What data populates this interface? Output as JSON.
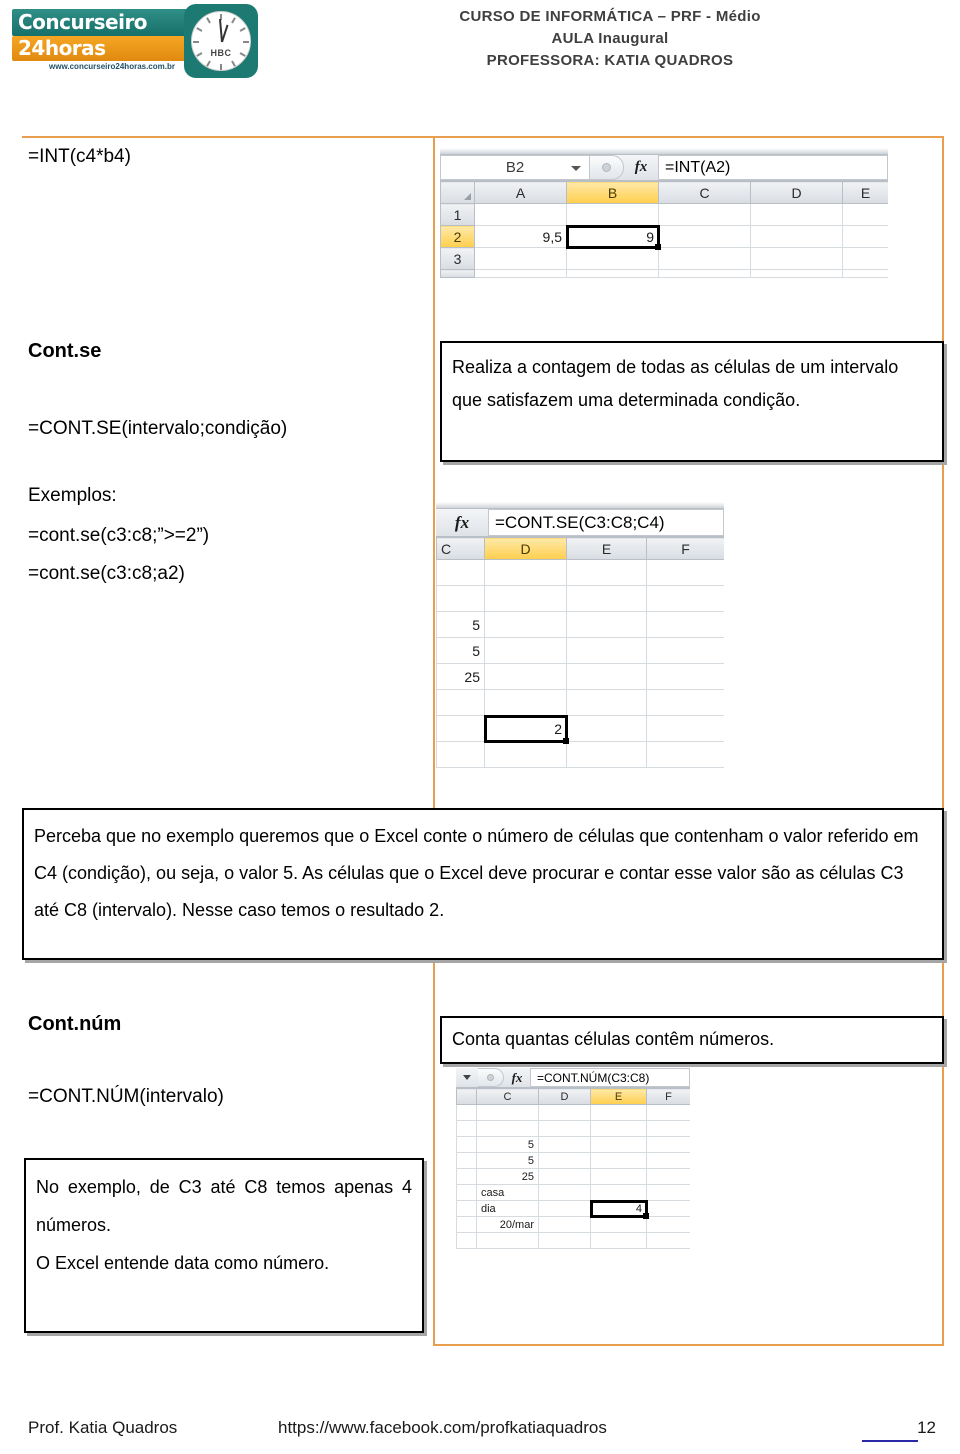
{
  "header": {
    "logo": {
      "brand_line1": "Concurseiro",
      "brand_line2": "24horas",
      "url": "www.concurseiro24horas.com.br",
      "clock_label": "HBC"
    },
    "title_line1": "CURSO DE INFORMÁTICA – PRF - Médio",
    "title_line2": "AULA Inaugural",
    "title_line3": "PROFESSORA: KATIA QUADROS",
    "title_color": "#3f3f3f"
  },
  "theme": {
    "table_border": "#e79e4f",
    "box_border": "#000000",
    "box_shadow": "#a6a6a6",
    "excel_selected_header": "#ffcf4d"
  },
  "rows": {
    "int": {
      "formula_text": "=INT(c4*b4)",
      "excel": {
        "namebox": "B2",
        "fx_label": "fx",
        "formula": "=INT(A2)",
        "columns": [
          "A",
          "B",
          "C",
          "D",
          "E"
        ],
        "selected_column": "B",
        "row_headers": [
          "1",
          "2",
          "3"
        ],
        "selected_row": "2",
        "cells": {
          "A2": "9,5",
          "B2": "9"
        },
        "active_cell": "B2"
      }
    },
    "contse": {
      "title": "Cont.se",
      "syntax": "=CONT.SE(intervalo;condição)",
      "examples_label": "Exemplos:",
      "example1": "=cont.se(c3:c8;”>=2”)",
      "example2": "=cont.se(c3:c8;a2)",
      "description": "Realiza a contagem de todas as células de um intervalo que satisfazem uma determinada condição.",
      "excel": {
        "fx_label": "fx",
        "formula": "=CONT.SE(C3:C8;C4)",
        "columns": [
          "C",
          "D",
          "E",
          "F"
        ],
        "selected_column": "D",
        "column_c_values": [
          "",
          "",
          "5",
          "5",
          "25",
          "",
          "",
          ""
        ],
        "active_cell_value": "2",
        "active_cell_col": "D",
        "active_cell_row_index": 6
      }
    },
    "perceba": {
      "text": "Perceba que no exemplo queremos que o Excel conte o número de células que contenham o valor referido em C4 (condição), ou seja, o valor 5. As células que o Excel deve procurar e contar esse valor são as células C3 até C8 (intervalo). Nesse caso temos o resultado 2."
    },
    "contnum": {
      "title": "Cont.núm",
      "syntax": "=CONT.NÚM(intervalo)",
      "description_right": "Conta quantas células contêm números.",
      "note_line1": "No exemplo, de C3 até C8 temos apenas 4 números.",
      "note_line2": "O Excel entende data como número.",
      "excel": {
        "fx_label": "fx",
        "formula": "=CONT.NÚM(C3:C8)",
        "columns": [
          "C",
          "D",
          "E",
          "F"
        ],
        "selected_column": "E",
        "column_c_values": [
          "",
          "",
          "5",
          "5",
          "25",
          "casa",
          "dia",
          "20/mar",
          ""
        ],
        "active_cell_value": "4",
        "active_cell_col": "E",
        "active_cell_row_index": 7
      }
    }
  },
  "footer": {
    "author": "Prof. Katia Quadros",
    "link": "https://www.facebook.com/profkatiaquadros",
    "page": "12"
  }
}
